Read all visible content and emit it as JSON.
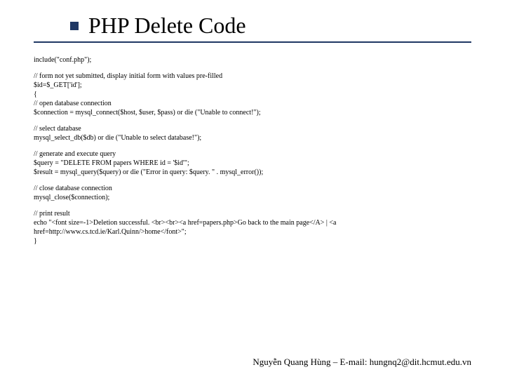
{
  "title": "PHP Delete Code",
  "lines": {
    "l0": "include(\"conf.php\");",
    "l1": "// form not yet submitted, display initial form with values pre-filled",
    "l2": "$id=$_GET['id'];",
    "l3": "{",
    "l4": "// open database connection",
    "l5": "$connection = mysql_connect($host, $user, $pass) or die (\"Unable to connect!\");",
    "l6": "// select database",
    "l7": "mysql_select_db($db) or die (\"Unable to select database!\");",
    "l8": "// generate and execute query",
    "l9": "$query = \"DELETE FROM papers WHERE id = '$id'\";",
    "l10": "$result = mysql_query($query) or die (\"Error in query: $query. \" . mysql_error());",
    "l11": "// close database connection",
    "l12": "mysql_close($connection);",
    "l13": "// print result",
    "l14": "echo \"<font size=-1>Deletion successful. <br><br><a href=papers.php>Go back to the main page</A> | <a href=http://www.cs.tcd.ie/Karl.Quinn/>home</font>\";",
    "l15": "}"
  },
  "footer": "Nguyễn Quang Hùng – E-mail: hungnq2@dit.hcmut.edu.vn"
}
